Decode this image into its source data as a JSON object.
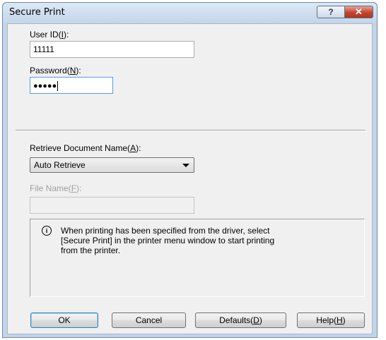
{
  "window": {
    "title": "Secure Print",
    "help_glyph": "?",
    "close_glyph": "✕"
  },
  "user_id": {
    "label_pre": "User ID(",
    "label_key": "I",
    "label_post": "):",
    "value": "11111"
  },
  "password": {
    "label_pre": "Password(",
    "label_key": "N",
    "label_post": "):",
    "masked_value": "●●●●●"
  },
  "retrieve": {
    "label_pre": "Retrieve Document Name(",
    "label_key": "A",
    "label_post": "):",
    "selected": "Auto Retrieve"
  },
  "file_name": {
    "label_pre": "File Name(",
    "label_key": "F",
    "label_post": "):",
    "value": ""
  },
  "info": {
    "icon": "info-icon",
    "line1": "When printing has been specified from the driver, select",
    "line2": "[Secure Print] in the printer menu window to start printing",
    "line3": "from the printer."
  },
  "buttons": {
    "ok": "OK",
    "cancel": "Cancel",
    "defaults_pre": "Defaults(",
    "defaults_key": "D",
    "defaults_post": ")",
    "help_pre": "Help(",
    "help_key": "H",
    "help_post": ")"
  }
}
